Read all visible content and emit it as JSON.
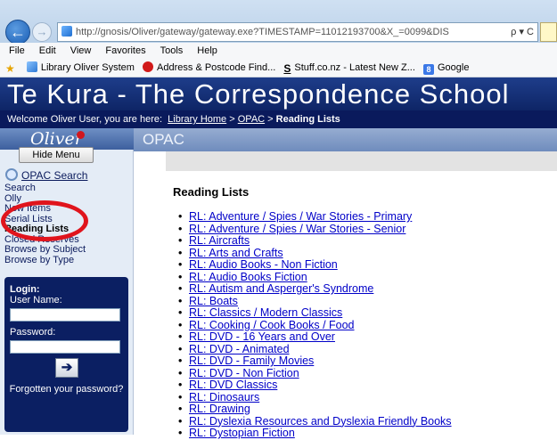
{
  "browser": {
    "url": "http://gnosis/Oliver/gateway/gateway.exe?TIMESTAMP=11012193700&X_=0099&DIS",
    "url_controls": "ρ ▾ C",
    "menu": [
      "File",
      "Edit",
      "View",
      "Favorites",
      "Tools",
      "Help"
    ],
    "favorites": [
      {
        "label": "Library Oliver System",
        "icon": "page-icon"
      },
      {
        "label": "Address & Postcode Find...",
        "icon": "red-circle-icon"
      },
      {
        "label": "Stuff.co.nz - Latest New Z...",
        "icon": "s-logo-icon"
      },
      {
        "label": "Google",
        "icon": "google-icon"
      }
    ]
  },
  "site": {
    "banner": "Te Kura - The Correspondence School",
    "welcome": "Welcome Oliver User,  you are here:",
    "crumbs": [
      "Library Home",
      "OPAC"
    ],
    "crumb_sep": ">",
    "crumb_current": "Reading Lists",
    "logo": "Oliver"
  },
  "sidebar": {
    "hide_menu": "Hide Menu",
    "opac_search": "OPAC Search",
    "nav": [
      "Search",
      "Olly",
      "New Items",
      "Serial Lists",
      "Reading Lists",
      "Closed Reserves",
      "Browse by Subject",
      "Browse by Type"
    ],
    "active_nav": "Reading Lists",
    "login": {
      "title": "Login:",
      "username_label": "User Name:",
      "password_label": "Password:",
      "forgot": "Forgotten your password?"
    }
  },
  "main": {
    "section": "OPAC",
    "heading": "Reading Lists",
    "lists": [
      "RL: Adventure / Spies / War Stories - Primary",
      "RL: Adventure / Spies / War Stories - Senior",
      "RL: Aircrafts",
      "RL: Arts and Crafts",
      "RL: Audio Books - Non Fiction",
      "RL: Audio Books Fiction",
      "RL: Autism and Asperger's Syndrome",
      "RL: Boats",
      "RL: Classics / Modern Classics",
      "RL: Cooking / Cook Books / Food",
      "RL: DVD - 16 Years and Over",
      "RL: DVD - Animated",
      "RL: DVD - Family Movies",
      "RL: DVD - Non Fiction",
      "RL: DVD Classics",
      "RL: Dinosaurs",
      "RL: Drawing",
      "RL: Dyslexia Resources and Dyslexia Friendly Books",
      "RL: Dystopian Fiction"
    ]
  },
  "colors": {
    "banner": "#1e3d8a",
    "crumb_bar": "#0a1a5c",
    "link": "#0000c8",
    "highlight_circle": "#e0141c"
  }
}
